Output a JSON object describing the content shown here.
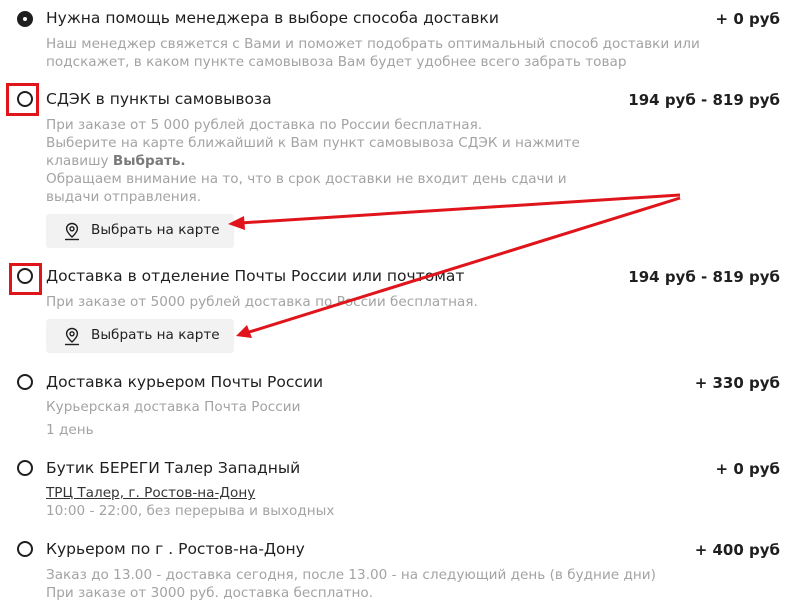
{
  "options": [
    {
      "title": "Нужна помощь менеджера в выборе способа доставки",
      "price": "+ 0 руб",
      "lines": [
        "Наш менеджер свяжется с Вами и поможет подобрать оптимальный способ доставки или",
        "подскажет, в каком пункте самовывоза Вам будет удобнее всего забрать товар"
      ]
    },
    {
      "title": "СДЭК в пункты самовывоза",
      "price": "194 руб - 819 руб",
      "lines": [
        "При заказе от 5 000 рублей доставка по России бесплатная.",
        "Выберите на карте ближайший к Вам пункт самовывоза СДЭК и нажмите",
        "клавишу ",
        "Выбрать.",
        "Обращаем внимание на то, что в срок доставки не входит день сдачи и",
        "выдачи отправления."
      ],
      "button": "Выбрать на карте"
    },
    {
      "title": "Доставка в отделение Почты России или почтомат",
      "price": "194 руб - 819 руб",
      "lines": [
        "При заказе от 5000 рублей доставка по России бесплатная."
      ],
      "button": "Выбрать на карте"
    },
    {
      "title": "Доставка курьером Почты России",
      "price": "+ 330 руб",
      "lines": [
        "Курьерская доставка Почта России",
        "1 день"
      ]
    },
    {
      "title": "Бутик БЕРЕГИ Талер Западный",
      "price": "+ 0 руб",
      "link": "ТРЦ Талер, г. Ростов-на-Дону",
      "lines": [
        "10:00 - 22:00, без перерыва и выходных"
      ]
    },
    {
      "title": "Курьером по г . Ростов-на-Дону",
      "price": "+ 400 руб",
      "lines": [
        "Заказ до 13.00 - доставка сегодня, после 13.00 - на следующий день (в будние дни)",
        "При заказе от 3000 руб. доставка бесплатно."
      ]
    }
  ],
  "colors": {
    "annotation": "#e0141b",
    "muted_text": "#a3a3a3",
    "button_bg": "#f2f2f2"
  },
  "icons": {
    "map_button": "map-pin-icon"
  }
}
